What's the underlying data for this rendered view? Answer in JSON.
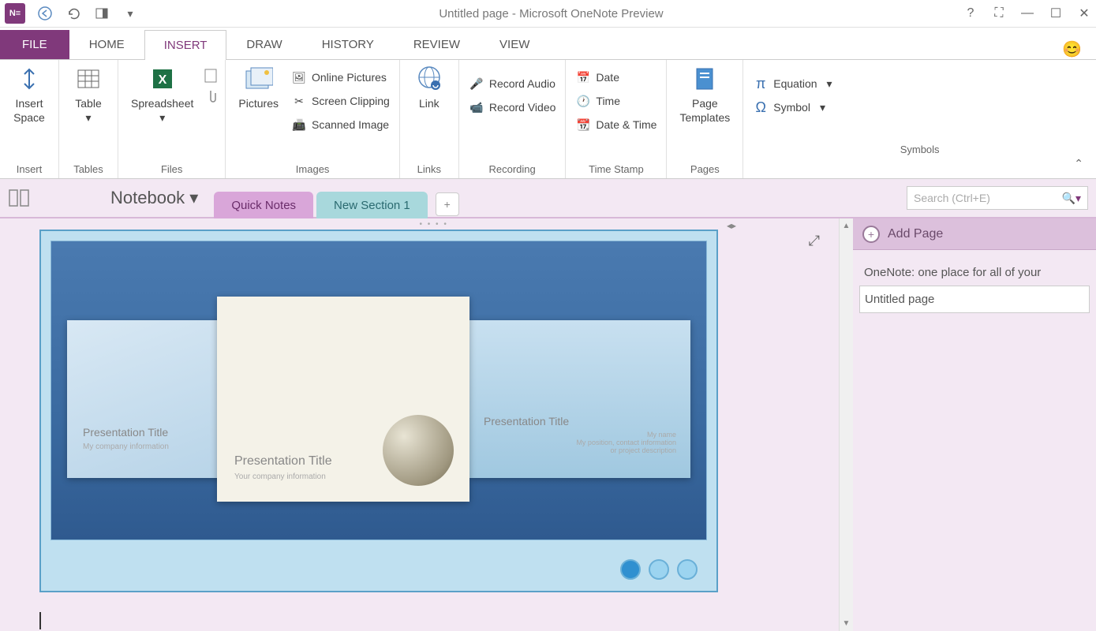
{
  "titlebar": {
    "app_label": "N≡",
    "title": "Untitled page - Microsoft OneNote Preview"
  },
  "ribbon_tabs": {
    "file": "FILE",
    "items": [
      "HOME",
      "INSERT",
      "DRAW",
      "HISTORY",
      "REVIEW",
      "VIEW"
    ],
    "active_index": 1
  },
  "ribbon": {
    "groups": [
      {
        "label": "Insert",
        "buttons": [
          {
            "label": "Insert\nSpace"
          }
        ]
      },
      {
        "label": "Tables",
        "buttons": [
          {
            "label": "Table"
          }
        ]
      },
      {
        "label": "Files",
        "buttons": [
          {
            "label": "Spreadsheet"
          }
        ],
        "extras": [
          "file-icon",
          "attach-icon"
        ]
      },
      {
        "label": "Images",
        "buttons": [
          {
            "label": "Pictures"
          }
        ],
        "small": [
          "Online Pictures",
          "Screen Clipping",
          "Scanned Image"
        ]
      },
      {
        "label": "Links",
        "buttons": [
          {
            "label": "Link"
          }
        ]
      },
      {
        "label": "Recording",
        "small": [
          "Record Audio",
          "Record Video"
        ]
      },
      {
        "label": "Time Stamp",
        "small": [
          "Date",
          "Time",
          "Date & Time"
        ]
      },
      {
        "label": "Pages",
        "buttons": [
          {
            "label": "Page\nTemplates"
          }
        ]
      },
      {
        "label": "Symbols",
        "small": [
          "Equation",
          "Symbol"
        ]
      }
    ]
  },
  "notebook_bar": {
    "notebook_label": "Notebook",
    "sections": [
      {
        "label": "Quick Notes",
        "color": "purple"
      },
      {
        "label": "New Section 1",
        "color": "teal"
      }
    ],
    "search_placeholder": "Search (Ctrl+E)"
  },
  "rightpane": {
    "add_page_label": "Add Page",
    "pages": [
      {
        "title": "OneNote: one place for all of your",
        "selected": false
      },
      {
        "title": "Untitled page",
        "selected": true
      }
    ]
  },
  "canvas": {
    "slides": [
      {
        "title": "Presentation Title",
        "sub": "My company information"
      },
      {
        "title": "Presentation Title",
        "sub": "Your company information"
      },
      {
        "title": "Presentation Title",
        "sub": "My name\nMy position, contact information\nor project description"
      }
    ]
  }
}
